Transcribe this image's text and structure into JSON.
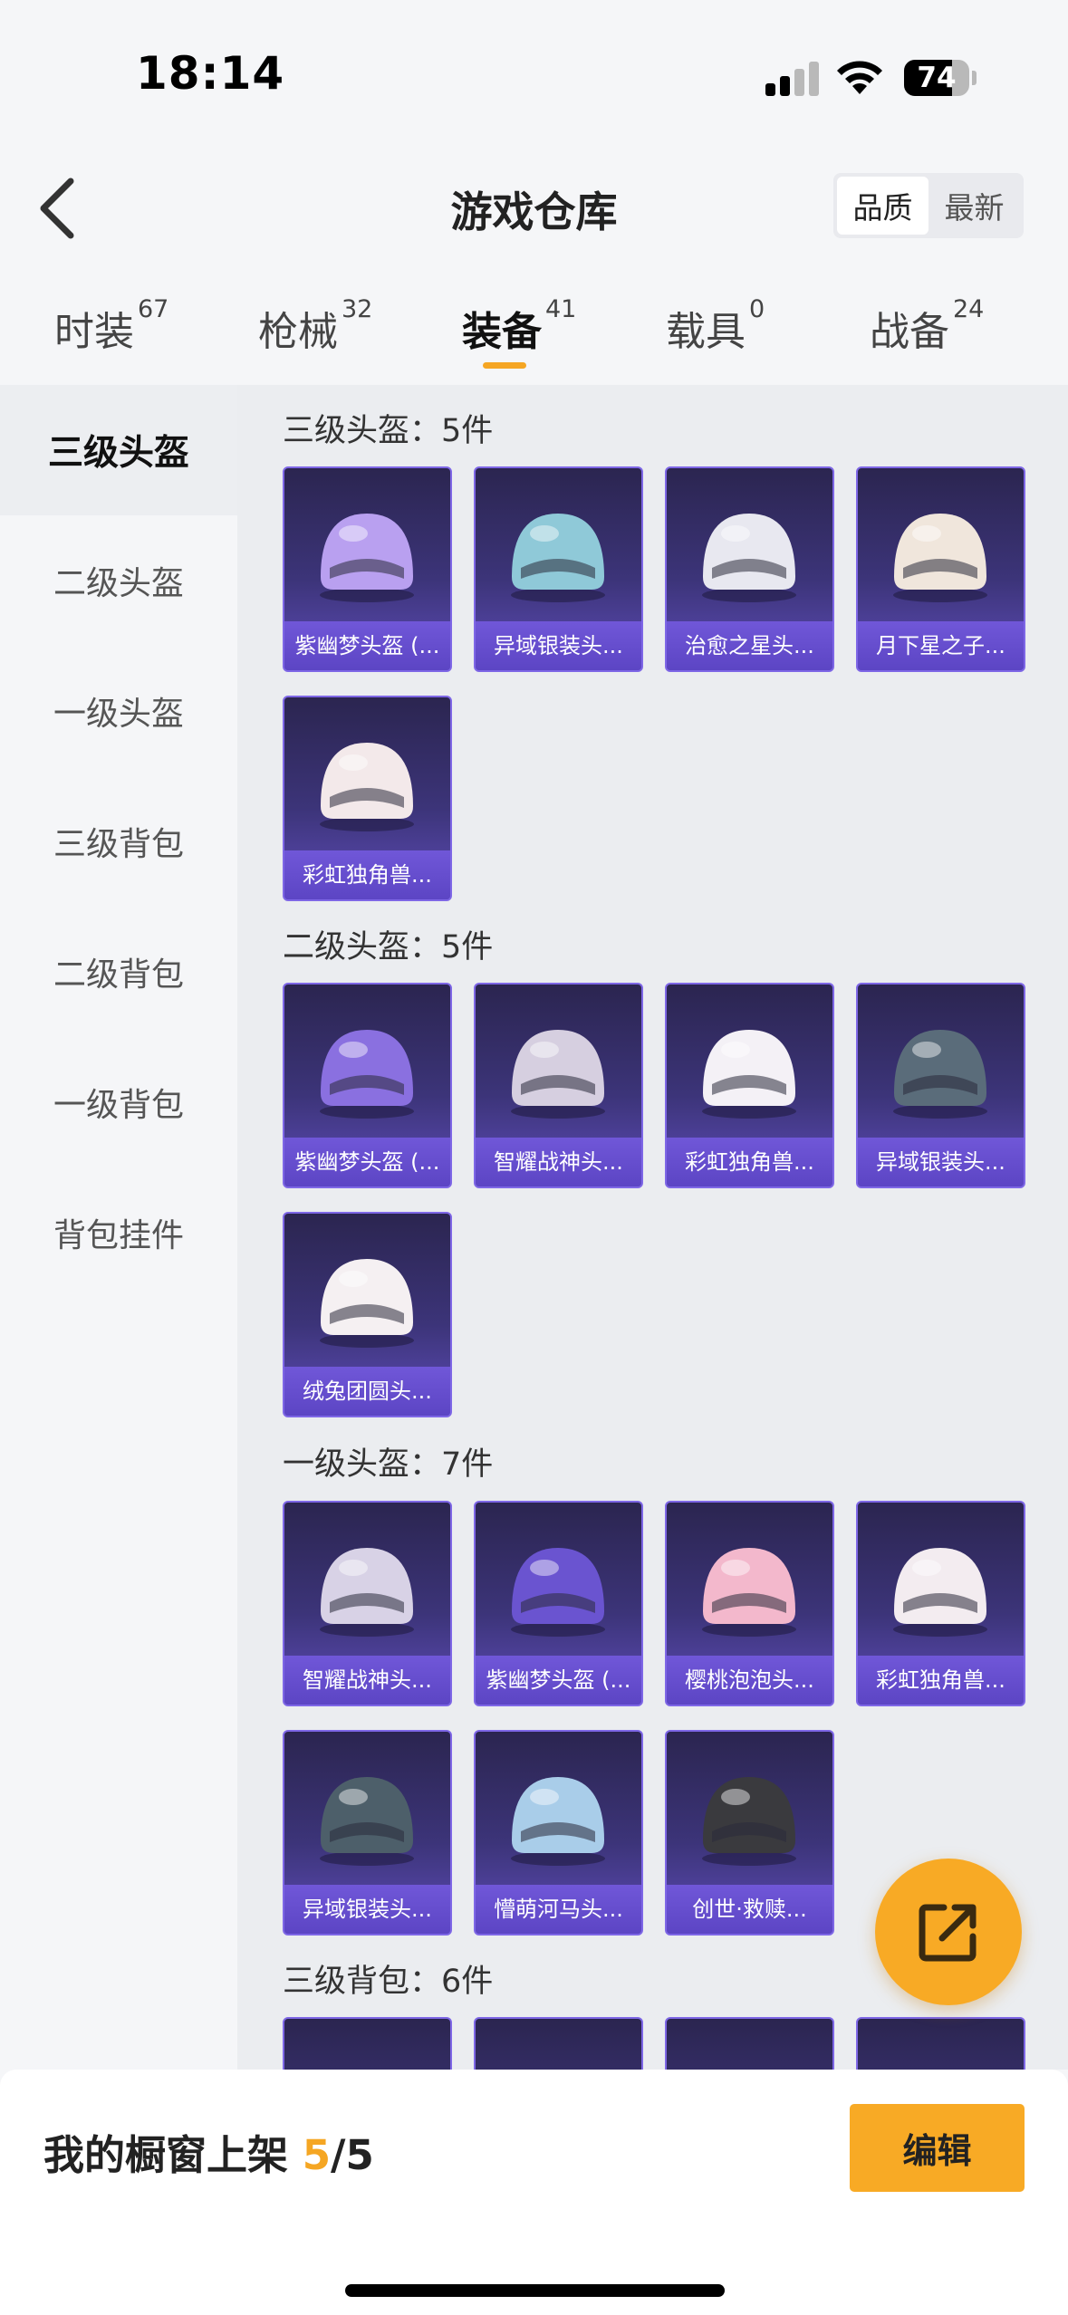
{
  "status_bar": {
    "time": "18:14",
    "battery": "74",
    "battery_level": 0.74,
    "signal_bars": "2 of 4"
  },
  "header": {
    "back_icon": "chevron-left-icon",
    "title": "游戏仓库",
    "sort_options": [
      "品质",
      "最新"
    ],
    "sort_active": "品质"
  },
  "tabs": [
    {
      "label": "时装",
      "count": "67"
    },
    {
      "label": "枪械",
      "count": "32"
    },
    {
      "label": "装备",
      "count": "41"
    },
    {
      "label": "载具",
      "count": "0"
    },
    {
      "label": "战备",
      "count": "24"
    }
  ],
  "active_tab": "装备",
  "accent_color": "#f5a623",
  "sidebar": {
    "items": [
      "三级头盔",
      "二级头盔",
      "一级头盔",
      "三级背包",
      "二级背包",
      "一级背包",
      "背包挂件"
    ],
    "active": "三级头盔"
  },
  "sections": [
    {
      "title": "三级头盔：5件",
      "items": [
        {
          "name": "紫幽梦头盔 (...",
          "color": "#b9a0f0"
        },
        {
          "name": "异域银装头...",
          "color": "#8fc9d8"
        },
        {
          "name": "治愈之星头...",
          "color": "#e8e8f0"
        },
        {
          "name": "月下星之子...",
          "color": "#f0e6dc"
        },
        {
          "name": "彩虹独角兽...",
          "color": "#f3e9ea"
        }
      ]
    },
    {
      "title": "二级头盔：5件",
      "items": [
        {
          "name": "紫幽梦头盔 (...",
          "color": "#8a70e0"
        },
        {
          "name": "智耀战神头...",
          "color": "#d6cfe0"
        },
        {
          "name": "彩虹独角兽...",
          "color": "#f4f1f6"
        },
        {
          "name": "异域银装头...",
          "color": "#5a6c7a"
        },
        {
          "name": "绒兔团圆头...",
          "color": "#f5f0f2"
        }
      ]
    },
    {
      "title": "一级头盔：7件",
      "items": [
        {
          "name": "智耀战神头...",
          "color": "#d8d2e6"
        },
        {
          "name": "紫幽梦头盔 (...",
          "color": "#6a54d0"
        },
        {
          "name": "樱桃泡泡头...",
          "color": "#f3b8cc"
        },
        {
          "name": "彩虹独角兽...",
          "color": "#f3ecf0"
        },
        {
          "name": "异域银装头...",
          "color": "#4d5f6a"
        },
        {
          "name": "懵萌河马头...",
          "color": "#a9cde9"
        },
        {
          "name": "创世·救赎...",
          "color": "#3a3a3e"
        }
      ]
    },
    {
      "title": "三级背包：6件",
      "items": [
        {
          "name": "",
          "color": "#c8a060"
        },
        {
          "name": "",
          "color": "#e0e0e0"
        },
        {
          "name": "",
          "color": "#f0c8d8"
        },
        {
          "name": "",
          "color": "#f4f0f0"
        }
      ]
    }
  ],
  "share_icon": "share-external-icon",
  "bottom_bar": {
    "label": "我的橱窗上架",
    "current": "5",
    "separator": "/",
    "total": "5",
    "edit_label": "编辑"
  }
}
